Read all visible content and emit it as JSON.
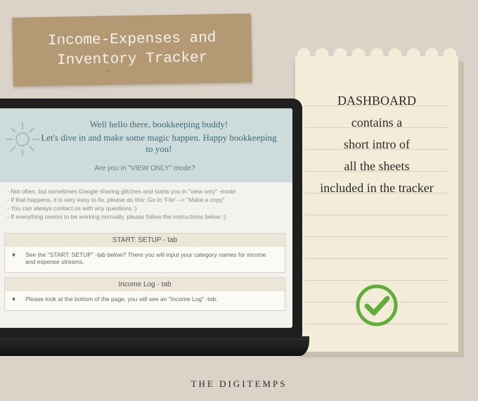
{
  "title_card": {
    "line1": "Income-Expenses and",
    "line2": "Inventory Tracker"
  },
  "notepad": {
    "lines": [
      "DASHBOARD",
      "contains a",
      "short intro of",
      "all the sheets",
      "included in the tracker"
    ],
    "check_color": "#5fae3a"
  },
  "screen": {
    "hero": {
      "greeting1": "Well hello there, bookkeeping buddy!",
      "greeting2": "Let's dive in and make some magic happen. Happy bookkeeping to you!",
      "question": "Are you in \"VIEW ONLY\" mode?"
    },
    "notes": [
      "- Not often, but sometimes Google sharing glitches and starts you in \"view only\" -mode",
      "- If that happens, it is very easy to fix, please do this: Go to 'File' --> \"Make a copy\"",
      "- You can always contact us with any questions :)",
      "- If everything seems to be working normally, please follow the instructions below :)"
    ],
    "sections": [
      {
        "title": "START: SETUP - tab",
        "body": "See the \"START: SETUP\" -tab below? There you will input your category names for income and expense streams."
      },
      {
        "title": "Income Log - tab",
        "body": "Please look at the bottom of the page, you will see an \"Income Log\" -tab."
      }
    ]
  },
  "brand": "THE DIGITEMPS"
}
